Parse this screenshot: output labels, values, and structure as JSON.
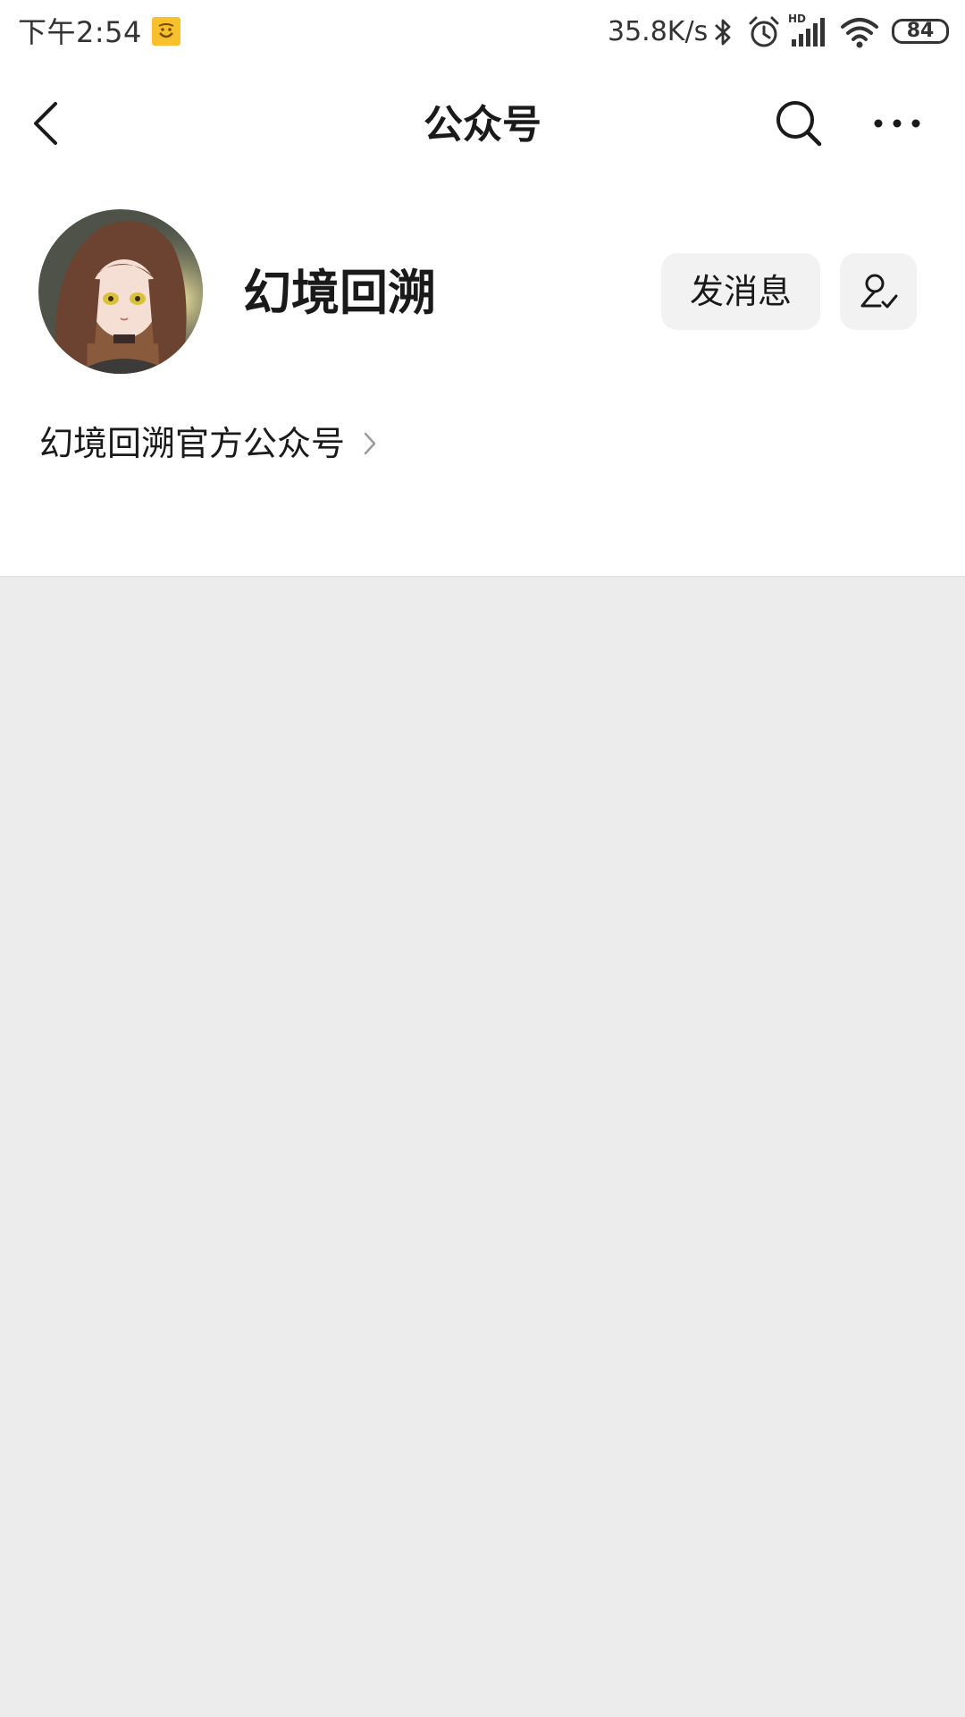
{
  "status_bar": {
    "time": "下午2:54",
    "net_speed": "35.8K/s",
    "signal_label": "HD",
    "battery": "84",
    "icons": [
      "notification-app-icon",
      "bluetooth-icon",
      "alarm-icon",
      "signal-icon",
      "wifi-icon",
      "battery-icon"
    ]
  },
  "header": {
    "title": "公众号",
    "icons": [
      "back-icon",
      "search-icon",
      "more-icon"
    ]
  },
  "profile": {
    "name": "幻境回溯",
    "message_button": "发消息",
    "follow_icon": "user-check-icon",
    "description": "幻境回溯官方公众号"
  },
  "colors": {
    "page_bg": "#ececec",
    "card_bg": "#ffffff",
    "button_bg": "#f2f2f2",
    "text": "#1a1a1a",
    "notif_icon": "#f6c12b"
  }
}
